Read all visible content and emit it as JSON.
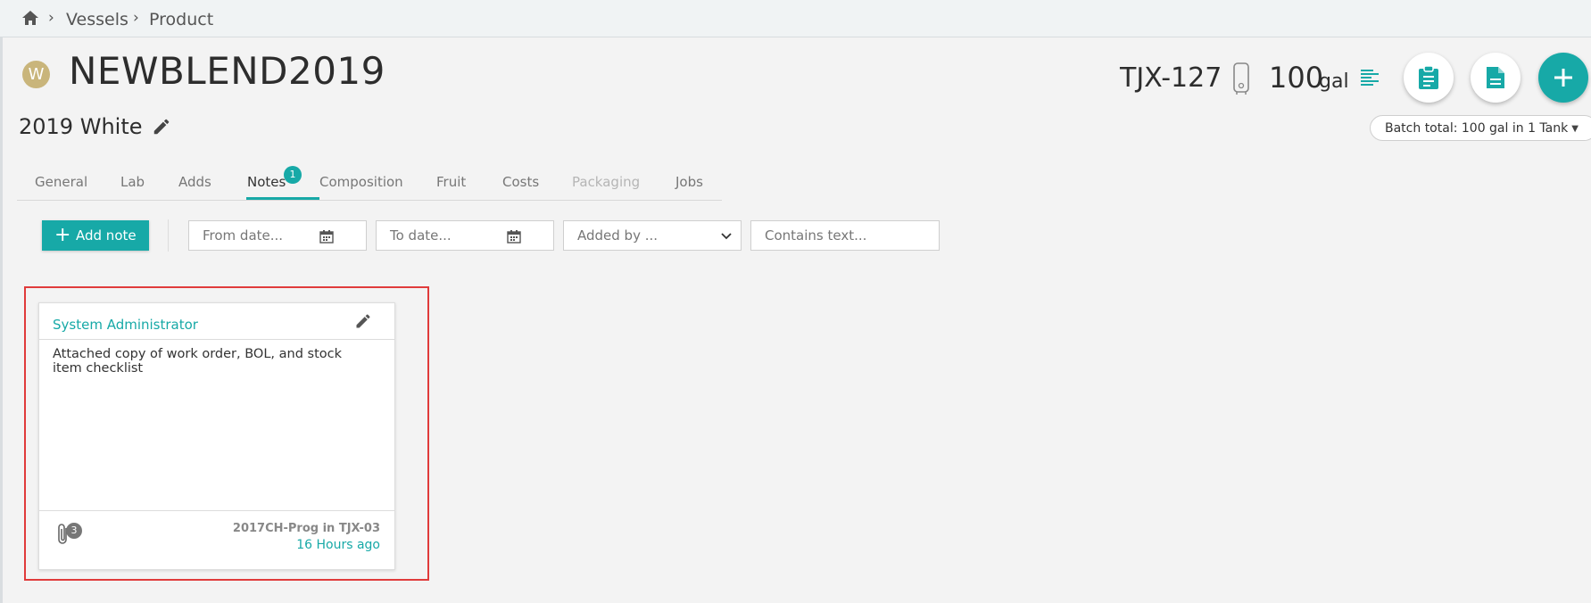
{
  "breadcrumb": {
    "items": [
      "Vessels",
      "Product"
    ],
    "separator": "›"
  },
  "header": {
    "avatar_letter": "W",
    "title": "NEWBLEND2019",
    "subtitle": "2019 White",
    "vessel_code": "TJX-127",
    "volume": "100",
    "volume_unit": "gal",
    "batch_total": "Batch total: 100 gal in 1 Tank"
  },
  "tabs": [
    {
      "label": "General"
    },
    {
      "label": "Lab"
    },
    {
      "label": "Adds"
    },
    {
      "label": "Notes",
      "active": true,
      "badge": "1"
    },
    {
      "label": "Composition"
    },
    {
      "label": "Fruit"
    },
    {
      "label": "Costs"
    },
    {
      "label": "Packaging",
      "disabled": true
    },
    {
      "label": "Jobs"
    }
  ],
  "toolbar": {
    "add_note_label": "Add note",
    "from_date_placeholder": "From date...",
    "to_date_placeholder": "To date...",
    "added_by_placeholder": "Added by ...",
    "contains_text_placeholder": "Contains text..."
  },
  "note": {
    "author": "System Administrator",
    "text": "Attached copy of work order, BOL, and stock item checklist",
    "attachment_count": "3",
    "vessel": "2017CH-Prog in TJX-03",
    "time": "16 Hours ago"
  },
  "colors": {
    "accent": "#17a9a7",
    "highlight": "#e03b3b",
    "avatar": "#c9b57b"
  }
}
